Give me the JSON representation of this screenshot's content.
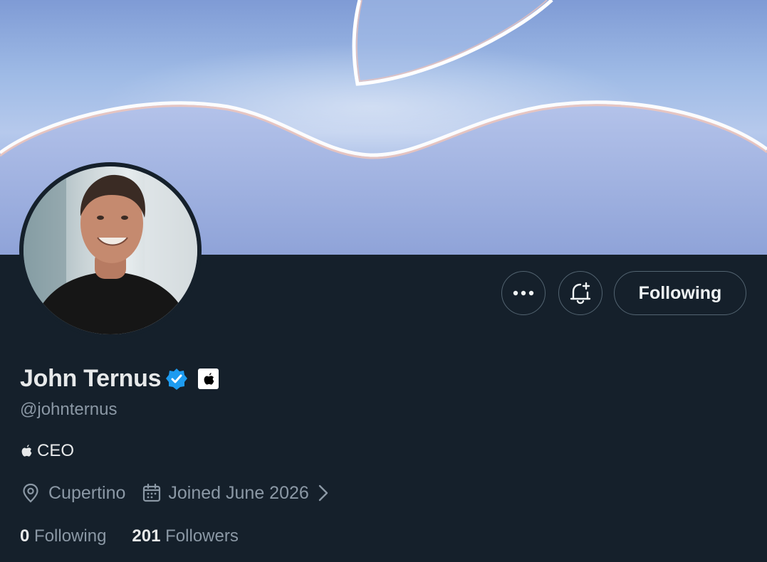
{
  "profile": {
    "display_name": "John Ternus",
    "handle": "@johnternus",
    "bio": "CEO",
    "location": "Cupertino",
    "joined": "Joined June 2026",
    "following_count": "0",
    "following_label": "Following",
    "followers_count": "201",
    "followers_label": "Followers"
  },
  "actions": {
    "more_icon": "more-icon",
    "notify_icon": "bell-plus-icon",
    "follow_state_label": "Following"
  },
  "icons": {
    "verified": "verified-badge-icon",
    "affiliate": "apple-logo-icon",
    "location": "location-pin-icon",
    "calendar": "calendar-icon"
  },
  "colors": {
    "background": "#15202b",
    "verified_blue": "#1d9bf0",
    "secondary_text": "#8b98a5"
  }
}
